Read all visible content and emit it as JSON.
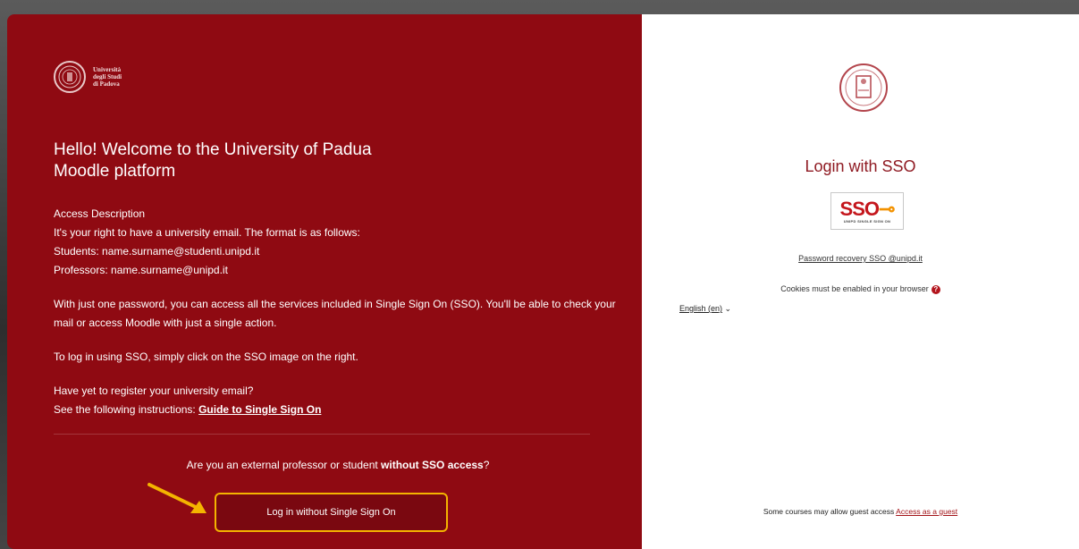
{
  "left": {
    "logo_lines": [
      "Università",
      "degli Studi",
      "di Padova"
    ],
    "title": "Hello! Welcome to the University of Padua Moodle platform",
    "access_description": "Access Description",
    "email_format": "It's your right to have a university email. The format is as follows:",
    "students": "Students: name.surname@studenti.unipd.it",
    "professors": "Professors: name.surname@unipd.it",
    "sso_info": "With just one password, you can access all the services included in Single Sign On (SSO). You'll be able to check your mail or access Moodle with just a single action.",
    "sso_howto": "To log in using SSO, simply click on the SSO image on the right.",
    "register_q": "Have yet to register your university email?",
    "instructions_prefix": "See the following instructions: ",
    "guide_link": "Guide to Single Sign On",
    "external_prefix": "Are you an external professor or student ",
    "external_bold": "without SSO access",
    "external_suffix": "?",
    "nosso_button": "Log in without Single Sign On"
  },
  "right": {
    "login_title": "Login with SSO",
    "sso_logo_text": "SSO",
    "sso_logo_sub": "UNIPD SINGLE SIGN ON",
    "password_recovery": "Password recovery SSO @unipd.it",
    "cookies": "Cookies must be enabled in your browser",
    "language": "English (en)",
    "guest_prefix": "Some courses may allow guest access ",
    "guest_link": "Access as a guest"
  },
  "colors": {
    "left_bg": "#8f0a12",
    "highlight": "#f4b400",
    "accent": "#8f1a22"
  },
  "icons": [
    "university-seal-icon",
    "question-icon",
    "chevron-down-icon",
    "arrow-icon"
  ]
}
